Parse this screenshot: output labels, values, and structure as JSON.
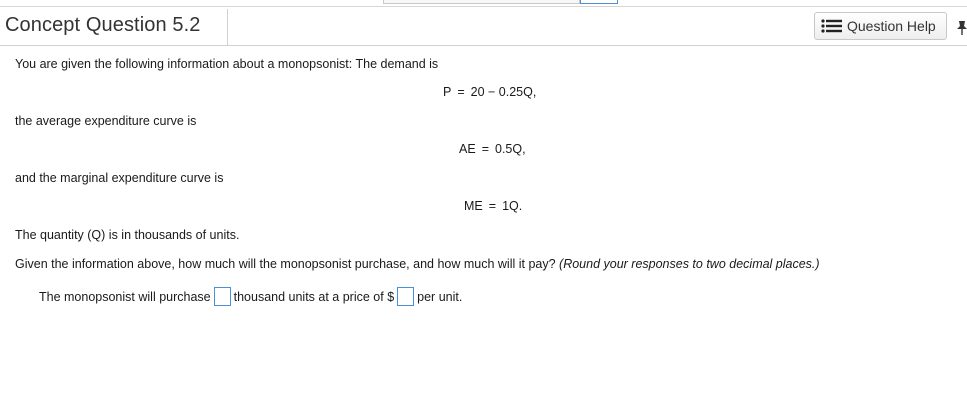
{
  "header": {
    "title": "Concept Question 5.2",
    "help_button_label": "Question Help",
    "help_icon": "list-icon",
    "pin_icon": "pin-icon"
  },
  "question": {
    "intro": "You are given the following information about a monopsonist:  The demand is",
    "demand_eq": {
      "lhs": "P",
      "op": "=",
      "rhs": "20 − 0.25Q,"
    },
    "ae_intro": "the average expenditure curve is",
    "ae_eq": {
      "lhs": "AE",
      "op": "=",
      "rhs": "0.5Q,"
    },
    "me_intro": "and the marginal expenditure curve is",
    "me_eq": {
      "lhs": "ME",
      "op": "=",
      "rhs": "1Q."
    },
    "units_note": "The quantity (Q) is in thousands of units.",
    "prompt": "Given the information above, how much will the monopsonist purchase, and how much will it pay? ",
    "instruction": "(Round your responses to two decimal places.)"
  },
  "answer": {
    "prefix": "The monopsonist will purchase",
    "quantity_value": "",
    "middle": "thousand units at a price of $",
    "price_value": "",
    "suffix": "per unit."
  },
  "colors": {
    "accent": "#4a90d9",
    "border": "#d0d0d0",
    "text": "#1a1a1a"
  }
}
